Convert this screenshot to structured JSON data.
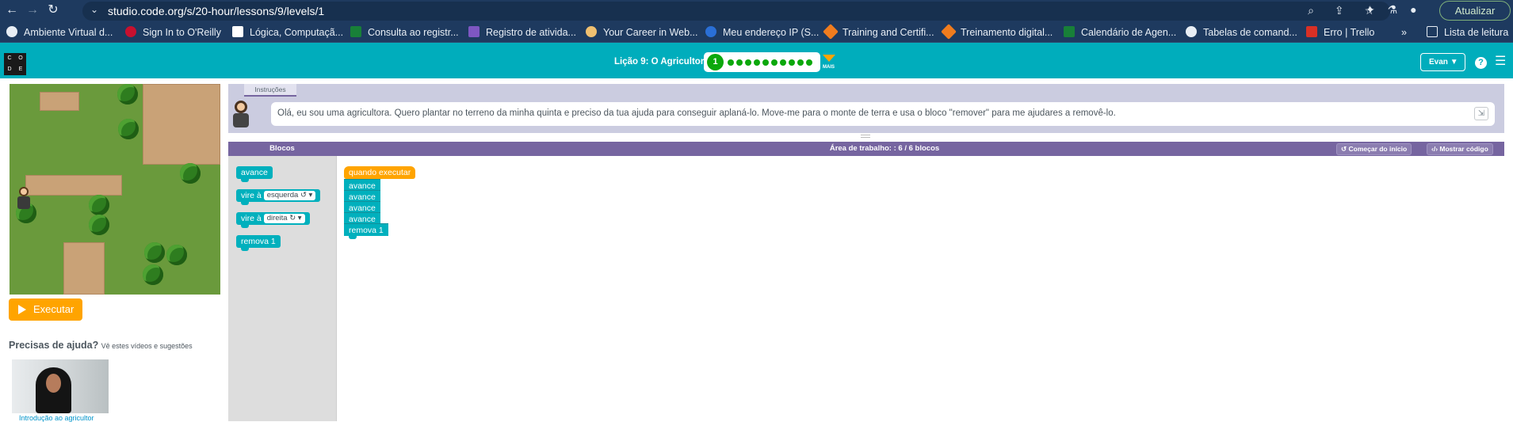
{
  "browser": {
    "url": "studio.code.org/s/20-hour/lessons/9/levels/1",
    "update_label": "Atualizar",
    "bookmarks": [
      {
        "label": "Ambiente Virtual d...",
        "color": "#e8eef5"
      },
      {
        "label": "Sign In to O'Reilly",
        "color": "#c8102e"
      },
      {
        "label": "Lógica, Computaçã...",
        "color": "#ffffff"
      },
      {
        "label": "Consulta ao registr...",
        "color": "#188038"
      },
      {
        "label": "Registro de ativida...",
        "color": "#7e57c2"
      },
      {
        "label": "Your Career in Web...",
        "color": "#f0c070"
      },
      {
        "label": "Meu endereço IP (S...",
        "color": "#2a6fd6"
      },
      {
        "label": "Training and Certifi...",
        "color": "#f07c1e"
      },
      {
        "label": "Treinamento digital...",
        "color": "#f07c1e"
      },
      {
        "label": "Calendário de Agen...",
        "color": "#188038"
      },
      {
        "label": "Tabelas de comand...",
        "color": "#e8eef5"
      },
      {
        "label": "Erro | Trello",
        "color": "#d93025"
      }
    ],
    "more_bookmarks": "»",
    "reading_list": "Lista de leitura"
  },
  "header": {
    "logo_letters": [
      "C",
      "O",
      "D",
      "E"
    ],
    "lesson_title": "Lição 9: O Agricultor",
    "current_level": "1",
    "progress_dots": 10,
    "more_label": "MAIS",
    "user_label": "Evan",
    "help_label": "?"
  },
  "left": {
    "run_label": "Executar",
    "help_title": "Precisas de ajuda?",
    "help_subtitle": "Vê estes vídeos e sugestões",
    "video_caption": "Introdução ao agricultor"
  },
  "instructions": {
    "tab_label": "Instruções",
    "text": "Olá, eu sou uma agricultora. Quero plantar no terreno da minha quinta e preciso da tua ajuda para conseguir aplaná-lo. Move-me para o monte de terra e usa o bloco \"remover\" para me ajudares a removê-lo."
  },
  "workspace": {
    "toolbox_title": "Blocos",
    "title": "Área de trabalho: : 6 / 6 blocos",
    "restart_label": "Começar do início",
    "show_code_label": "Mostrar código",
    "toolbox_blocks": [
      {
        "label": "avance"
      },
      {
        "label": "vire à",
        "option": "esquerda ↺"
      },
      {
        "label": "vire à",
        "option": "direita ↻"
      },
      {
        "label": "remova 1"
      }
    ],
    "program": {
      "event": "quando executar",
      "blocks": [
        "avance",
        "avance",
        "avance",
        "avance",
        "remova 1"
      ]
    }
  }
}
